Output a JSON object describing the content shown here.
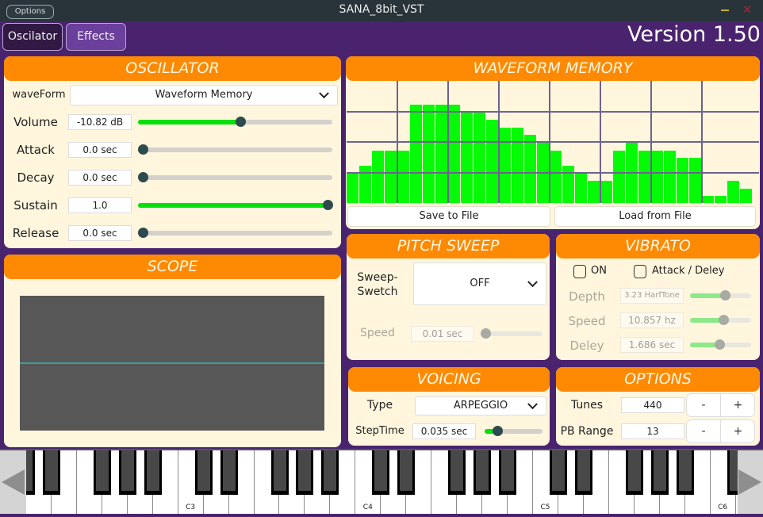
{
  "window": {
    "title": "SANA_8bit_VST",
    "options_label": "Options",
    "minimize_icon": "minimize-icon",
    "close_icon": "close-icon",
    "close_glyph": "✕"
  },
  "tabs": [
    {
      "label": "Oscilator",
      "active": true
    },
    {
      "label": "Effects",
      "active": false
    }
  ],
  "version": "Version 1.50",
  "oscillator": {
    "title": "OSCILLATOR",
    "waveform_label": "waveForm",
    "waveform_value": "Waveform Memory",
    "params": [
      {
        "label": "Volume",
        "value": "-10.82 dB",
        "fraction": 0.53,
        "filled": true
      },
      {
        "label": "Attack",
        "value": "0.0 sec",
        "fraction": 0.0,
        "filled": false
      },
      {
        "label": "Decay",
        "value": "0.0 sec",
        "fraction": 0.0,
        "filled": false
      },
      {
        "label": "Sustain",
        "value": "1.0",
        "fraction": 1.0,
        "filled": true
      },
      {
        "label": "Release",
        "value": "0.0 sec",
        "fraction": 0.0,
        "filled": false
      }
    ]
  },
  "scope": {
    "title": "SCOPE",
    "line_color": "#3f9d9b"
  },
  "waveform_memory": {
    "title": "WAVEFORM MEMORY",
    "max_level": 16,
    "levels": [
      4,
      5,
      7,
      7,
      7,
      13,
      13,
      13,
      13,
      12,
      12,
      11,
      10,
      10,
      9,
      8,
      7,
      5,
      4,
      3,
      3,
      7,
      8,
      7,
      7,
      7,
      6,
      6,
      1,
      1,
      3,
      2
    ],
    "save_label": "Save to File",
    "load_label": "Load from File",
    "bar_color": "#05fb05"
  },
  "pitch_sweep": {
    "title": "PITCH SWEEP",
    "switch_label": "Sweep-\nSwetch",
    "switch_label_1": "Sweep-",
    "switch_label_2": "Swetch",
    "switch_value": "OFF",
    "speed_label": "Speed",
    "speed_value": "0.01 sec",
    "speed_fraction": 0.0
  },
  "vibrato": {
    "title": "VIBRATO",
    "on_label": "ON",
    "on_checked": false,
    "attack_delay_label": "Attack / Deley",
    "attack_delay_checked": false,
    "params": [
      {
        "label": "Depth",
        "value": "3.23 HarfTone",
        "fraction": 0.58
      },
      {
        "label": "Speed",
        "value": "10.857 hz",
        "fraction": 0.55
      },
      {
        "label": "Deley",
        "value": "1.686 sec",
        "fraction": 0.48
      }
    ]
  },
  "voicing": {
    "title": "VOICING",
    "type_label": "Type",
    "type_value": "ARPEGGIO",
    "steptime_label": "StepTime",
    "steptime_value": "0.035 sec",
    "steptime_fraction": 0.17
  },
  "options": {
    "title": "OPTIONS",
    "tunes_label": "Tunes",
    "tunes_value": "440",
    "pb_label": "PB Range",
    "pb_value": "13",
    "minus_label": "-",
    "plus_label": "+"
  },
  "keyboard": {
    "first_white_note": "D2",
    "white_key_count": 29,
    "labels": {
      "C3": "C3",
      "C4": "C4",
      "C5": "C5",
      "C6": "C6"
    },
    "scroll_left_icon": "triangle-left-icon",
    "scroll_right_icon": "triangle-right-icon"
  }
}
